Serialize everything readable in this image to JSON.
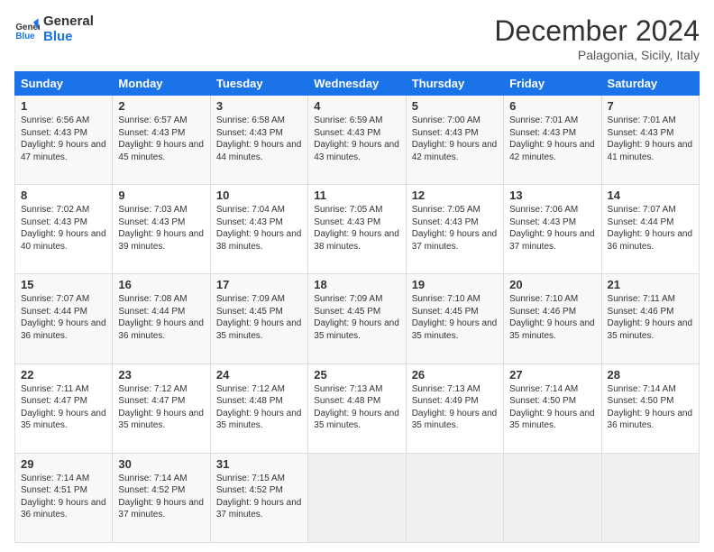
{
  "header": {
    "logo": {
      "line1": "General",
      "line2": "Blue"
    },
    "title": "December 2024",
    "subtitle": "Palagonia, Sicily, Italy"
  },
  "weekdays": [
    "Sunday",
    "Monday",
    "Tuesday",
    "Wednesday",
    "Thursday",
    "Friday",
    "Saturday"
  ],
  "weeks": [
    [
      {
        "day": "1",
        "sunrise": "6:56 AM",
        "sunset": "4:43 PM",
        "daylight": "9 hours and 47 minutes."
      },
      {
        "day": "2",
        "sunrise": "6:57 AM",
        "sunset": "4:43 PM",
        "daylight": "9 hours and 45 minutes."
      },
      {
        "day": "3",
        "sunrise": "6:58 AM",
        "sunset": "4:43 PM",
        "daylight": "9 hours and 44 minutes."
      },
      {
        "day": "4",
        "sunrise": "6:59 AM",
        "sunset": "4:43 PM",
        "daylight": "9 hours and 43 minutes."
      },
      {
        "day": "5",
        "sunrise": "7:00 AM",
        "sunset": "4:43 PM",
        "daylight": "9 hours and 42 minutes."
      },
      {
        "day": "6",
        "sunrise": "7:01 AM",
        "sunset": "4:43 PM",
        "daylight": "9 hours and 42 minutes."
      },
      {
        "day": "7",
        "sunrise": "7:01 AM",
        "sunset": "4:43 PM",
        "daylight": "9 hours and 41 minutes."
      }
    ],
    [
      {
        "day": "8",
        "sunrise": "7:02 AM",
        "sunset": "4:43 PM",
        "daylight": "9 hours and 40 minutes."
      },
      {
        "day": "9",
        "sunrise": "7:03 AM",
        "sunset": "4:43 PM",
        "daylight": "9 hours and 39 minutes."
      },
      {
        "day": "10",
        "sunrise": "7:04 AM",
        "sunset": "4:43 PM",
        "daylight": "9 hours and 38 minutes."
      },
      {
        "day": "11",
        "sunrise": "7:05 AM",
        "sunset": "4:43 PM",
        "daylight": "9 hours and 38 minutes."
      },
      {
        "day": "12",
        "sunrise": "7:05 AM",
        "sunset": "4:43 PM",
        "daylight": "9 hours and 37 minutes."
      },
      {
        "day": "13",
        "sunrise": "7:06 AM",
        "sunset": "4:43 PM",
        "daylight": "9 hours and 37 minutes."
      },
      {
        "day": "14",
        "sunrise": "7:07 AM",
        "sunset": "4:44 PM",
        "daylight": "9 hours and 36 minutes."
      }
    ],
    [
      {
        "day": "15",
        "sunrise": "7:07 AM",
        "sunset": "4:44 PM",
        "daylight": "9 hours and 36 minutes."
      },
      {
        "day": "16",
        "sunrise": "7:08 AM",
        "sunset": "4:44 PM",
        "daylight": "9 hours and 36 minutes."
      },
      {
        "day": "17",
        "sunrise": "7:09 AM",
        "sunset": "4:45 PM",
        "daylight": "9 hours and 35 minutes."
      },
      {
        "day": "18",
        "sunrise": "7:09 AM",
        "sunset": "4:45 PM",
        "daylight": "9 hours and 35 minutes."
      },
      {
        "day": "19",
        "sunrise": "7:10 AM",
        "sunset": "4:45 PM",
        "daylight": "9 hours and 35 minutes."
      },
      {
        "day": "20",
        "sunrise": "7:10 AM",
        "sunset": "4:46 PM",
        "daylight": "9 hours and 35 minutes."
      },
      {
        "day": "21",
        "sunrise": "7:11 AM",
        "sunset": "4:46 PM",
        "daylight": "9 hours and 35 minutes."
      }
    ],
    [
      {
        "day": "22",
        "sunrise": "7:11 AM",
        "sunset": "4:47 PM",
        "daylight": "9 hours and 35 minutes."
      },
      {
        "day": "23",
        "sunrise": "7:12 AM",
        "sunset": "4:47 PM",
        "daylight": "9 hours and 35 minutes."
      },
      {
        "day": "24",
        "sunrise": "7:12 AM",
        "sunset": "4:48 PM",
        "daylight": "9 hours and 35 minutes."
      },
      {
        "day": "25",
        "sunrise": "7:13 AM",
        "sunset": "4:48 PM",
        "daylight": "9 hours and 35 minutes."
      },
      {
        "day": "26",
        "sunrise": "7:13 AM",
        "sunset": "4:49 PM",
        "daylight": "9 hours and 35 minutes."
      },
      {
        "day": "27",
        "sunrise": "7:14 AM",
        "sunset": "4:50 PM",
        "daylight": "9 hours and 35 minutes."
      },
      {
        "day": "28",
        "sunrise": "7:14 AM",
        "sunset": "4:50 PM",
        "daylight": "9 hours and 36 minutes."
      }
    ],
    [
      {
        "day": "29",
        "sunrise": "7:14 AM",
        "sunset": "4:51 PM",
        "daylight": "9 hours and 36 minutes."
      },
      {
        "day": "30",
        "sunrise": "7:14 AM",
        "sunset": "4:52 PM",
        "daylight": "9 hours and 37 minutes."
      },
      {
        "day": "31",
        "sunrise": "7:15 AM",
        "sunset": "4:52 PM",
        "daylight": "9 hours and 37 minutes."
      },
      null,
      null,
      null,
      null
    ]
  ],
  "labels": {
    "sunrise": "Sunrise:",
    "sunset": "Sunset:",
    "daylight": "Daylight:"
  }
}
